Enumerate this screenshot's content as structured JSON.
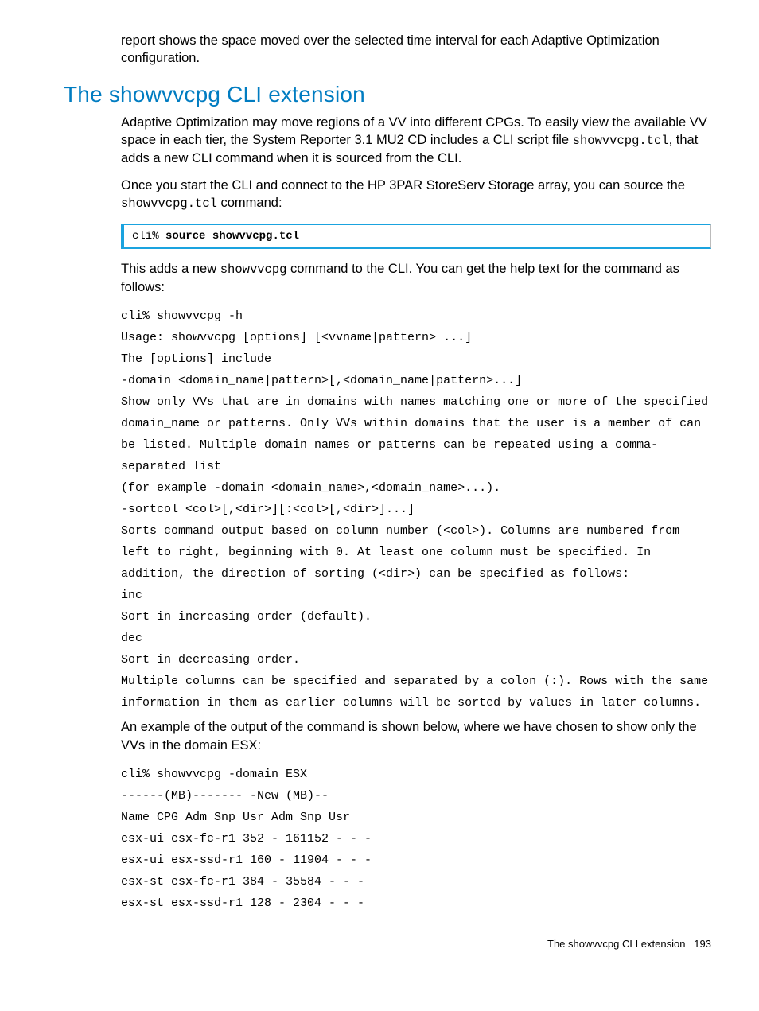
{
  "intro_paragraph": "report shows the space moved over the selected time interval for each Adaptive Optimization configuration.",
  "heading": "The showvvcpg CLI extension",
  "para1_before": "Adaptive Optimization may move regions of a VV into different CPGs. To easily view the available VV space in each tier, the System Reporter 3.1 MU2 CD includes a CLI script file ",
  "para1_code": "showvvcpg.tcl",
  "para1_after": ", that adds a new CLI command when it is sourced from the CLI.",
  "para2_before": "Once you start the CLI and connect to the HP 3PAR StoreServ Storage array, you can source the ",
  "para2_code": "showvvcpg.tcl",
  "para2_after": " command:",
  "codebox_prompt": "cli% ",
  "codebox_cmd": "source showvvcpg.tcl",
  "para3_before": "This adds a new ",
  "para3_code": "showvvcpg",
  "para3_after": " command to the CLI. You can get the help text for the command as follows:",
  "help_block": "cli% showvvcpg -h\nUsage: showvvcpg [options] [<vvname|pattern> ...]\nThe [options] include\n-domain <domain_name|pattern>[,<domain_name|pattern>...]\nShow only VVs that are in domains with names matching one or more of the specified domain_name or patterns. Only VVs within domains that the user is a member of can be listed. Multiple domain names or patterns can be repeated using a comma-separated list\n(for example -domain <domain_name>,<domain_name>...).\n-sortcol <col>[,<dir>][:<col>[,<dir>]...]\nSorts command output based on column number (<col>). Columns are numbered from left to right, beginning with 0. At least one column must be specified. In addition, the direction of sorting (<dir>) can be specified as follows:\ninc\nSort in increasing order (default).\ndec\nSort in decreasing order.\nMultiple columns can be specified and separated by a colon (:). Rows with the same information in them as earlier columns will be sorted by values in later columns.",
  "para4": "An example of the output of the command is shown below, where we have chosen to show only the VVs in the domain ESX:",
  "output_block": "cli% showvvcpg -domain ESX\n------(MB)------- -New (MB)--\nName CPG Adm Snp Usr Adm Snp Usr\nesx-ui esx-fc-r1 352 - 161152 - - -\nesx-ui esx-ssd-r1 160 - 11904 - - -\nesx-st esx-fc-r1 384 - 35584 - - -\nesx-st esx-ssd-r1 128 - 2304 - - -",
  "footer_text": "The showvvcpg CLI extension",
  "footer_page": "193"
}
